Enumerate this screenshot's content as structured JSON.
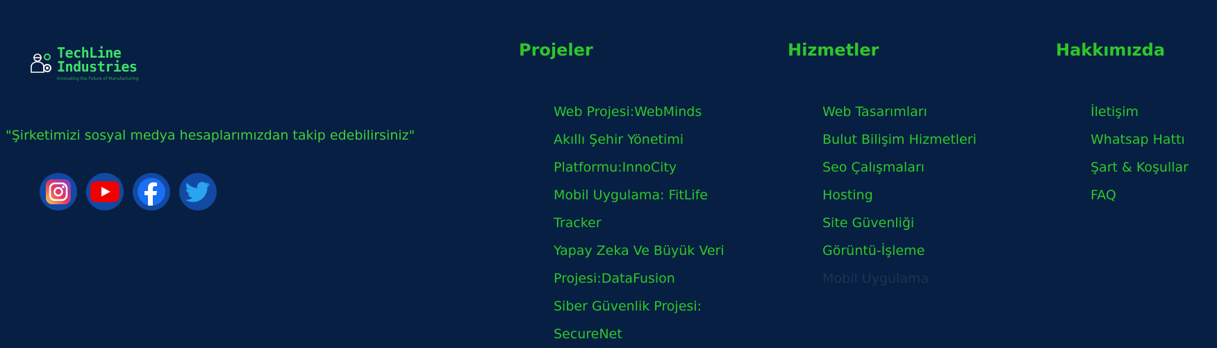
{
  "brand": {
    "name_line1": "TechLine",
    "name_line2": "Industries",
    "tagline": "Innovating the Future of Manufacturing"
  },
  "follow_text": "\"Şirketimizi sosyal medya hesaplarımızdan takip edebilirsiniz\"",
  "socials": [
    {
      "icon": "instagram-icon"
    },
    {
      "icon": "youtube-icon"
    },
    {
      "icon": "facebook-icon"
    },
    {
      "icon": "twitter-icon"
    }
  ],
  "columns": {
    "projeler": {
      "title": "Projeler",
      "items": [
        "Web Projesi:WebMinds",
        "Akıllı Şehir Yönetimi",
        "Platformu:InnoCity",
        "Mobil Uygulama: FitLife",
        "Tracker",
        "Yapay Zeka Ve Büyük Veri",
        "Projesi:DataFusion",
        "Siber Güvenlik Projesi:",
        "SecureNet"
      ]
    },
    "hizmetler": {
      "title": "Hizmetler",
      "items": [
        "Web Tasarımları",
        "Bulut Bilişim Hizmetleri",
        "Seo Çalışmaları",
        "Hosting",
        "Site Güvenliği",
        "Görüntü-İşleme",
        "Mobil Uygulama"
      ]
    },
    "hakkimizda": {
      "title": "Hakkımızda",
      "items": [
        "İletişim",
        "Whatsap Hattı",
        "Şart & Koşullar",
        "FAQ"
      ]
    }
  },
  "colors": {
    "background": "#071f42",
    "accent": "#2ec72a",
    "social_bg": "#1149a3"
  }
}
